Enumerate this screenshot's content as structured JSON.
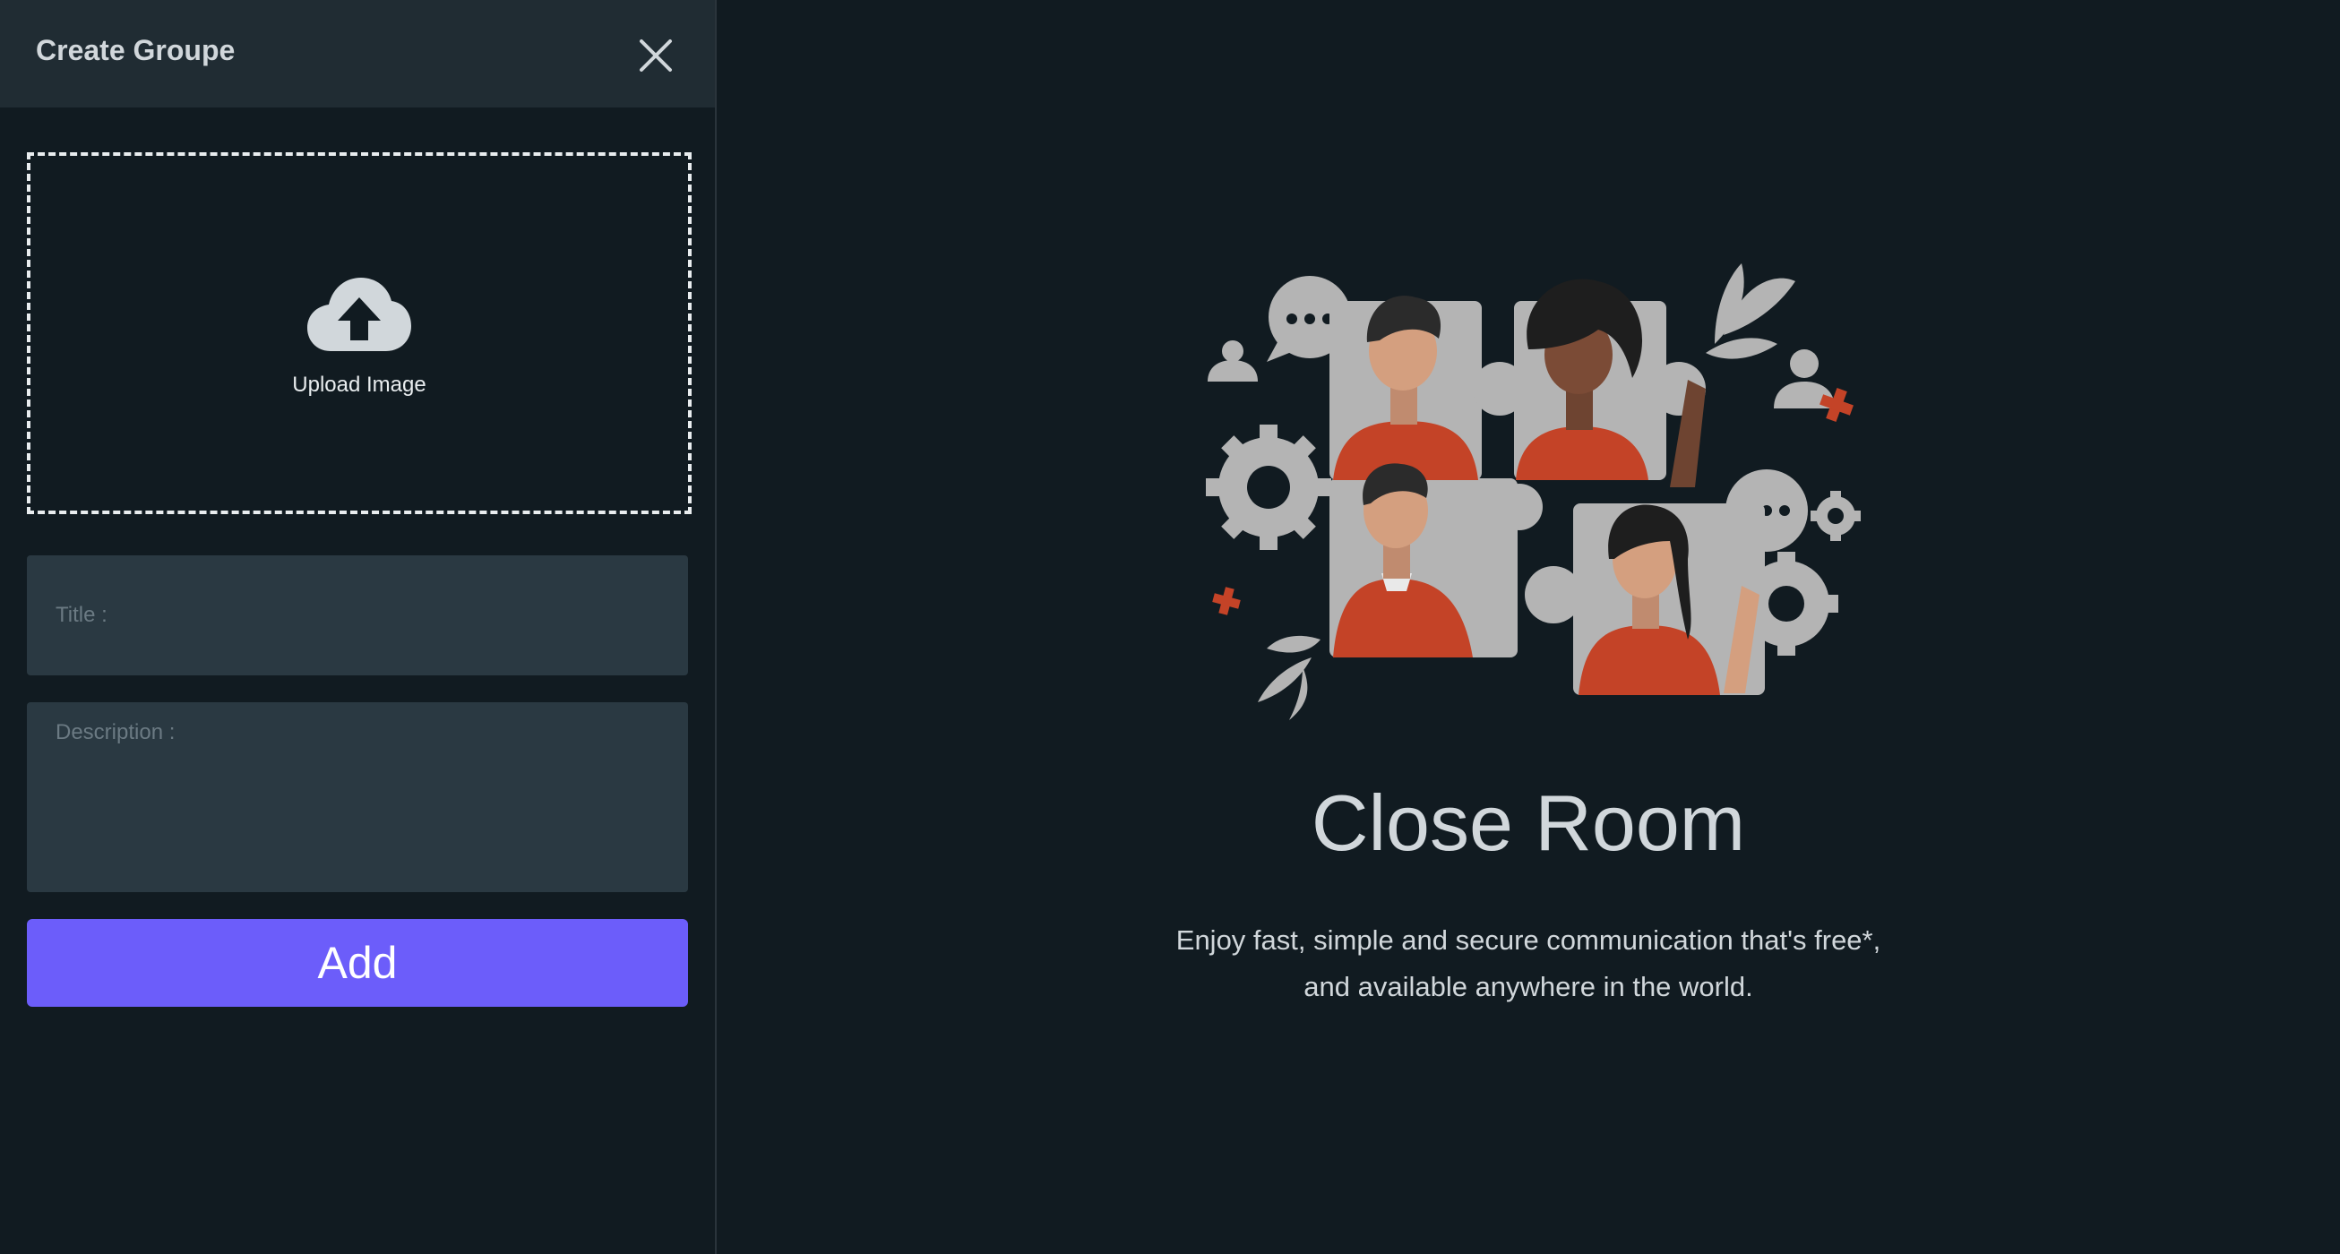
{
  "sidebar": {
    "header": {
      "title": "Create Groupe"
    },
    "upload": {
      "label": "Upload Image"
    },
    "form": {
      "title_placeholder": "Title :",
      "title_value": "",
      "description_placeholder": "Description :",
      "description_value": "",
      "add_label": "Add"
    }
  },
  "main": {
    "title": "Close Room",
    "description_lines": [
      "Enjoy fast, simple and secure communication that's free*,",
      "and available anywhere in the world."
    ]
  },
  "icons": {
    "close": "close-icon",
    "upload": "cloud-upload-icon"
  },
  "colors": {
    "background": "#111b21",
    "header": "#202c33",
    "input": "#2a3942",
    "accent": "#6c5dfa",
    "illustration_red": "#c44327",
    "illustration_gray": "#b4b4b4"
  }
}
